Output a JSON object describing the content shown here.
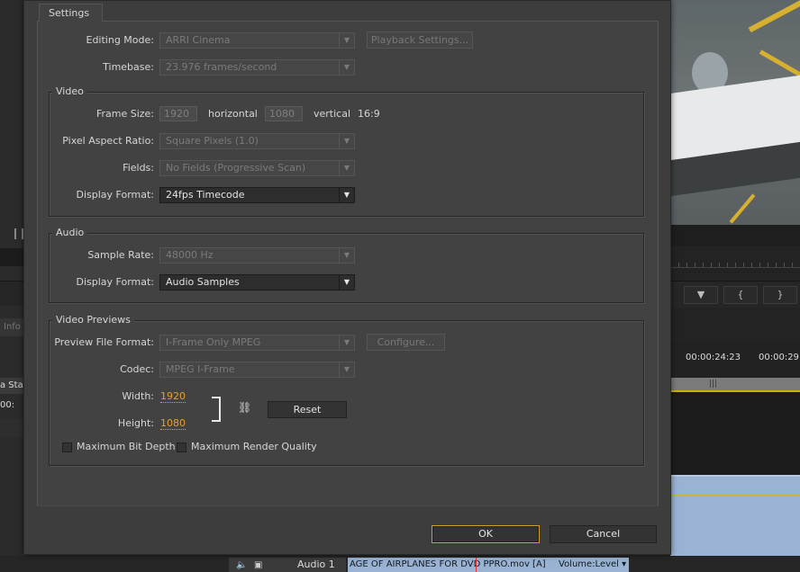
{
  "dialog": {
    "tab_label": "Settings",
    "editing_mode": {
      "label": "Editing Mode:",
      "value": "ARRI Cinema"
    },
    "playback_settings_label": "Playback Settings...",
    "timebase": {
      "label": "Timebase:",
      "value": "23.976 frames/second"
    },
    "video": {
      "title": "Video",
      "frame_size_label": "Frame Size:",
      "frame_width": "1920",
      "horizontal_label": "horizontal",
      "frame_height": "1080",
      "vertical_label": "vertical",
      "aspect": "16:9",
      "pixel_aspect": {
        "label": "Pixel Aspect Ratio:",
        "value": "Square Pixels (1.0)"
      },
      "fields": {
        "label": "Fields:",
        "value": "No Fields (Progressive Scan)"
      },
      "display_format": {
        "label": "Display Format:",
        "value": "24fps Timecode"
      }
    },
    "audio": {
      "title": "Audio",
      "sample_rate": {
        "label": "Sample Rate:",
        "value": "48000 Hz"
      },
      "display_format": {
        "label": "Display Format:",
        "value": "Audio Samples"
      }
    },
    "previews": {
      "title": "Video Previews",
      "file_format": {
        "label": "Preview File Format:",
        "value": "I-Frame Only MPEG"
      },
      "configure_label": "Configure...",
      "codec": {
        "label": "Codec:",
        "value": "MPEG I-Frame"
      },
      "width_label": "Width:",
      "width_value": "1920",
      "height_label": "Height:",
      "height_value": "1080",
      "reset_label": "Reset",
      "max_bit_depth_label": "Maximum Bit Depth",
      "max_render_quality_label": "Maximum Render Quality"
    },
    "ok_label": "OK",
    "cancel_label": "Cancel"
  },
  "background": {
    "left_info": "Info",
    "left_sta": "a Sta",
    "left_tc": "00:",
    "timecode_1": "00:00:24:23",
    "timecode_2": "00:00:29:",
    "ctrl_marker": "▼",
    "ctrl_in": "{",
    "ctrl_out": "}",
    "audio_track": "Audio 1",
    "clip_name": "AGE OF AIRPLANES FOR DVD PPRO.mov [A]",
    "clip_volume": "Volume:Level ▾",
    "colors": {
      "accent_orange": "#e8a12c",
      "ok_border": "#cfa02c",
      "clip_blue": "#9ab3d2",
      "workarea_yellow": "#c8b400"
    }
  }
}
